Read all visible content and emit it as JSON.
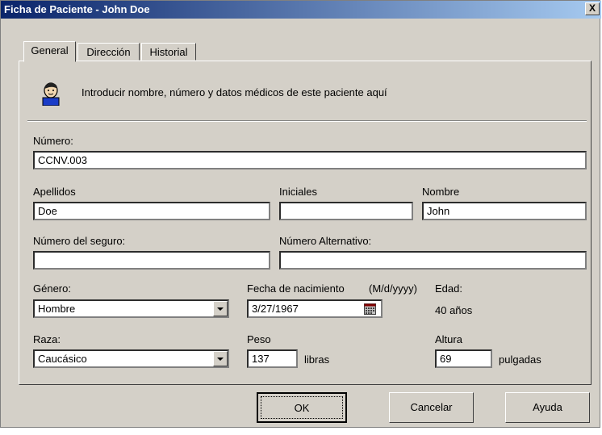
{
  "window": {
    "title": "Ficha de Paciente - John Doe",
    "close_label": "X"
  },
  "tabs": [
    {
      "label": "General",
      "active": true
    },
    {
      "label": "Dirección",
      "active": false
    },
    {
      "label": "Historial",
      "active": false
    }
  ],
  "header": {
    "icon": "patient-icon",
    "instruction": "Introducir nombre, número y datos médicos de este paciente aquí"
  },
  "fields": {
    "numero": {
      "label": "Número:",
      "value": "CCNV.003"
    },
    "apellidos": {
      "label": "Apellidos",
      "value": "Doe"
    },
    "iniciales": {
      "label": "Iniciales",
      "value": ""
    },
    "nombre": {
      "label": "Nombre",
      "value": "John"
    },
    "seguro": {
      "label": "Número del seguro:",
      "value": ""
    },
    "alternativo": {
      "label": "Número Alternativo:",
      "value": ""
    },
    "genero": {
      "label": "Género:",
      "value": "Hombre"
    },
    "nacimiento": {
      "label": "Fecha de nacimiento",
      "format": "(M/d/yyyy)",
      "value": "3/27/1967",
      "icon": "calendar-icon"
    },
    "edad": {
      "label": "Edad:",
      "value": "40 años"
    },
    "raza": {
      "label": "Raza:",
      "value": "Caucásico"
    },
    "peso": {
      "label": "Peso",
      "value": "137",
      "unit": "libras"
    },
    "altura": {
      "label": "Altura",
      "value": "69",
      "unit": "pulgadas"
    }
  },
  "buttons": {
    "ok": "OK",
    "cancel": "Cancelar",
    "help": "Ayuda"
  },
  "colors": {
    "titlebar_start": "#0a246a",
    "titlebar_end": "#a6caf0",
    "face": "#d4d0c8"
  }
}
